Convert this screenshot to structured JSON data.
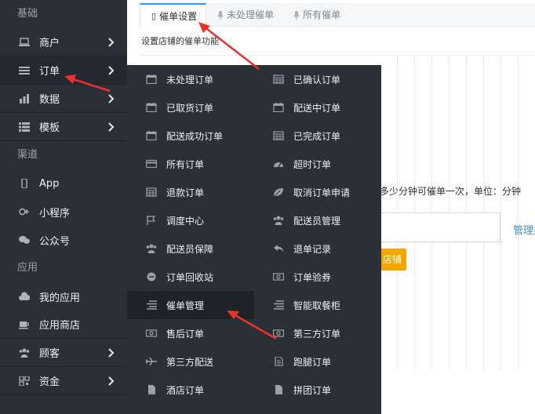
{
  "sidebar": {
    "sections": [
      {
        "label": "基础",
        "items": [
          {
            "label": "商户",
            "icon": "laptop-icon",
            "chevron": true
          },
          {
            "label": "订单",
            "icon": "list-icon",
            "chevron": true,
            "active": true
          },
          {
            "label": "数据",
            "icon": "bar-chart-icon",
            "chevron": true
          },
          {
            "label": "模板",
            "icon": "th-list-icon",
            "chevron": true
          }
        ]
      },
      {
        "label": "渠道",
        "items": [
          {
            "label": "App",
            "icon": "mobile-icon"
          },
          {
            "label": "小程序",
            "icon": "google-plus-icon"
          },
          {
            "label": "公众号",
            "icon": "wechat-icon"
          }
        ]
      },
      {
        "label": "应用",
        "items": [
          {
            "label": "我的应用",
            "icon": "cloud-icon"
          },
          {
            "label": "应用商店",
            "icon": "coffee-icon"
          },
          {
            "label": "顾客",
            "icon": "users-icon",
            "chevron": true
          },
          {
            "label": "资金",
            "icon": "qrcode-icon",
            "chevron": true
          }
        ]
      }
    ]
  },
  "tabs": [
    {
      "label": "催单设置",
      "active": true
    },
    {
      "label": "未处理催单"
    },
    {
      "label": "所有催单"
    }
  ],
  "main": {
    "description": "设置店铺的催单功能",
    "hint": "多少分钟可催单一次，单位：分钟",
    "manage_link": "管理推",
    "save_label": "店铺"
  },
  "submenu": {
    "left": [
      {
        "label": "未处理订单",
        "icon": "calendar-icon"
      },
      {
        "label": "已取货订单",
        "icon": "calendar-icon"
      },
      {
        "label": "配送成功订单",
        "icon": "calendar-icon"
      },
      {
        "label": "所有订单",
        "icon": "credit-card-icon"
      },
      {
        "label": "退款订单",
        "icon": "calendar-grid-icon"
      },
      {
        "label": "调度中心",
        "icon": "flag-icon"
      },
      {
        "label": "配送员保障",
        "icon": "users-icon"
      },
      {
        "label": "订单回收站",
        "icon": "minus-circle-icon"
      },
      {
        "label": "催单管理",
        "icon": "align-right-icon",
        "highlight": true
      },
      {
        "label": "售后订单",
        "icon": "money-icon"
      },
      {
        "label": "第三方配送",
        "icon": "plane-icon"
      },
      {
        "label": "酒店订单",
        "icon": "file-icon"
      }
    ],
    "right": [
      {
        "label": "已确认订单",
        "icon": "calendar-grid-icon"
      },
      {
        "label": "配送中订单",
        "icon": "calendar-icon"
      },
      {
        "label": "已完成订单",
        "icon": "calendar-grid-icon"
      },
      {
        "label": "超时订单",
        "icon": "dashboard-icon"
      },
      {
        "label": "取消订单申请",
        "icon": "leaf-icon"
      },
      {
        "label": "配送员管理",
        "icon": "users-icon"
      },
      {
        "label": "退单记录",
        "icon": "reply-icon"
      },
      {
        "label": "订单验券",
        "icon": "money-icon"
      },
      {
        "label": "智能取餐柜",
        "icon": "align-right-icon"
      },
      {
        "label": "第三方订单",
        "icon": "money-icon"
      },
      {
        "label": "跑腿订单",
        "icon": "file-text-icon"
      },
      {
        "label": "拼团订单",
        "icon": "file-icon"
      }
    ]
  },
  "colors": {
    "sidebar_bg": "#2b2f36",
    "accent": "#1e9fff",
    "save_btn": "#f4a500",
    "annotation": "#e8332c"
  }
}
